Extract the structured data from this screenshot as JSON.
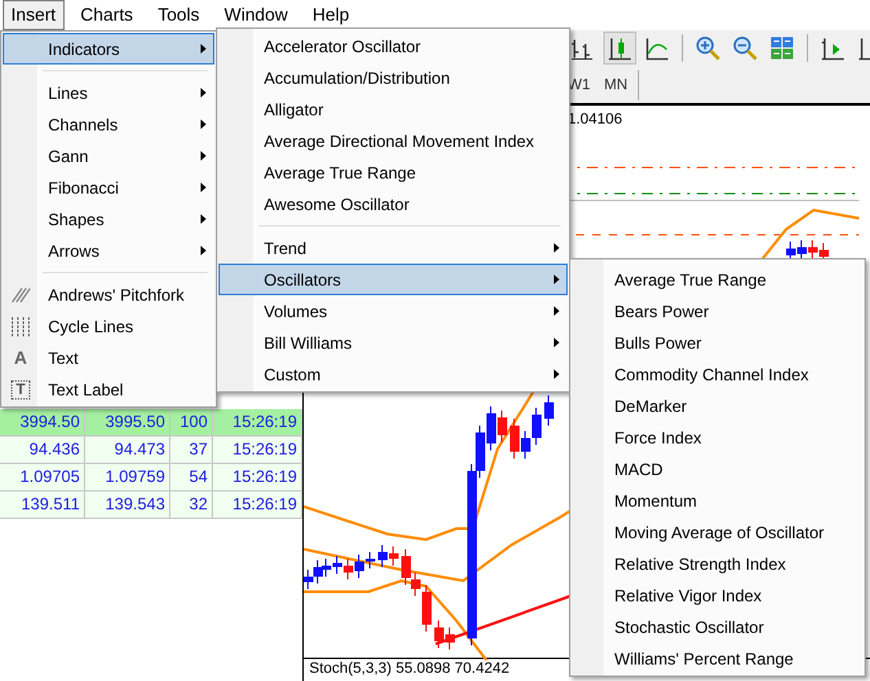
{
  "menu_bar": [
    {
      "label": "Insert",
      "selected": true
    },
    {
      "label": "Charts",
      "selected": false
    },
    {
      "label": "Tools",
      "selected": false
    },
    {
      "label": "Window",
      "selected": false
    },
    {
      "label": "Help",
      "selected": false
    }
  ],
  "toolbar": [
    {
      "kind": "bars",
      "selected": false
    },
    {
      "kind": "candles",
      "selected": true
    },
    {
      "kind": "line",
      "selected": false
    },
    {
      "kind": "separator"
    },
    {
      "kind": "zoom-in",
      "selected": false
    },
    {
      "kind": "zoom-out",
      "selected": false
    },
    {
      "kind": "tile",
      "selected": false
    },
    {
      "kind": "separator"
    },
    {
      "kind": "autoscroll",
      "selected": false
    },
    {
      "kind": "shift",
      "selected": false
    }
  ],
  "timeframes": [
    {
      "label": "W1"
    },
    {
      "label": "MN"
    }
  ],
  "market_watch": {
    "rows": [
      {
        "bid": "3994.50",
        "ask": "3995.50",
        "spread": "100",
        "time": "15:26:19",
        "highlighted": true
      },
      {
        "bid": "94.436",
        "ask": "94.473",
        "spread": "37",
        "time": "15:26:19",
        "highlighted": false
      },
      {
        "bid": "1.09705",
        "ask": "1.09759",
        "spread": "54",
        "time": "15:26:19",
        "highlighted": false
      },
      {
        "bid": "139.511",
        "ask": "139.543",
        "spread": "32",
        "time": "15:26:19",
        "highlighted": false
      }
    ]
  },
  "chart": {
    "price_label": "1.04106",
    "indicator_label": "Stoch(5,3,3) 55.0898 70.4242"
  },
  "insert_menu": {
    "items": [
      {
        "kind": "submenu",
        "label": "Indicators",
        "selected": true
      },
      {
        "kind": "separator"
      },
      {
        "kind": "submenu",
        "label": "Lines",
        "selected": false
      },
      {
        "kind": "submenu",
        "label": "Channels",
        "selected": false
      },
      {
        "kind": "submenu",
        "label": "Gann",
        "selected": false
      },
      {
        "kind": "submenu",
        "label": "Fibonacci",
        "selected": false
      },
      {
        "kind": "submenu",
        "label": "Shapes",
        "selected": false
      },
      {
        "kind": "submenu",
        "label": "Arrows",
        "selected": false
      },
      {
        "kind": "separator"
      },
      {
        "kind": "pitchfork",
        "label": "Andrews' Pitchfork",
        "selected": false
      },
      {
        "kind": "cycles",
        "label": "Cycle Lines",
        "selected": false
      },
      {
        "kind": "letter",
        "label": "Text",
        "glyph": "A",
        "selected": false
      },
      {
        "kind": "boxedletter",
        "label": "Text Label",
        "glyph": "T",
        "selected": false
      }
    ]
  },
  "indicators_menu": {
    "items": [
      {
        "kind": "item",
        "label": "Accelerator Oscillator",
        "selected": false
      },
      {
        "kind": "item",
        "label": "Accumulation/Distribution",
        "selected": false
      },
      {
        "kind": "item",
        "label": "Alligator",
        "selected": false
      },
      {
        "kind": "item",
        "label": "Average Directional Movement Index",
        "selected": false
      },
      {
        "kind": "item",
        "label": "Average True Range",
        "selected": false
      },
      {
        "kind": "item",
        "label": "Awesome Oscillator",
        "selected": false
      },
      {
        "kind": "separator"
      },
      {
        "kind": "submenu",
        "label": "Trend",
        "selected": false
      },
      {
        "kind": "submenu",
        "label": "Oscillators",
        "selected": true
      },
      {
        "kind": "submenu",
        "label": "Volumes",
        "selected": false
      },
      {
        "kind": "submenu",
        "label": "Bill Williams",
        "selected": false
      },
      {
        "kind": "submenu",
        "label": "Custom",
        "selected": false
      }
    ]
  },
  "oscillators_menu": {
    "items": [
      {
        "kind": "item",
        "label": "Average True Range",
        "selected": false
      },
      {
        "kind": "item",
        "label": "Bears Power",
        "selected": false
      },
      {
        "kind": "item",
        "label": "Bulls Power",
        "selected": false
      },
      {
        "kind": "item",
        "label": "Commodity Channel Index",
        "selected": false
      },
      {
        "kind": "item",
        "label": "DeMarker",
        "selected": false
      },
      {
        "kind": "item",
        "label": "Force Index",
        "selected": false
      },
      {
        "kind": "item",
        "label": "MACD",
        "selected": false
      },
      {
        "kind": "item",
        "label": "Momentum",
        "selected": false
      },
      {
        "kind": "item",
        "label": "Moving Average of Oscillator",
        "selected": false
      },
      {
        "kind": "item",
        "label": "Relative Strength Index",
        "selected": false
      },
      {
        "kind": "item",
        "label": "Relative Vigor Index",
        "selected": false
      },
      {
        "kind": "item",
        "label": "Stochastic Oscillator",
        "selected": false
      },
      {
        "kind": "item",
        "label": "Williams' Percent Range",
        "selected": false
      }
    ]
  }
}
